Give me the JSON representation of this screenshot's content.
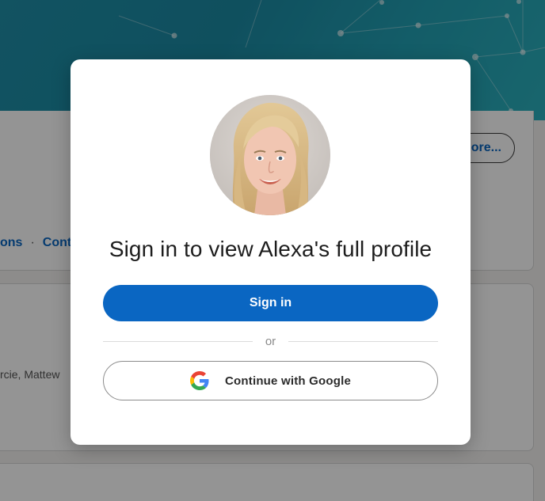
{
  "background": {
    "more_button_label": "More...",
    "links": [
      "ons",
      "Contact info"
    ],
    "people_text": "rcie, Mattew"
  },
  "modal": {
    "title": "Sign in to view Alexa's full profile",
    "sign_in_label": "Sign in",
    "divider_text": "or",
    "google_label": "Continue with Google",
    "icons": {
      "avatar": "profile-photo",
      "google": "google-g-icon"
    }
  },
  "colors": {
    "primary": "#0a66c2",
    "overlay": "rgba(0,0,0,0.42)",
    "cover": "#1f8fa8"
  }
}
